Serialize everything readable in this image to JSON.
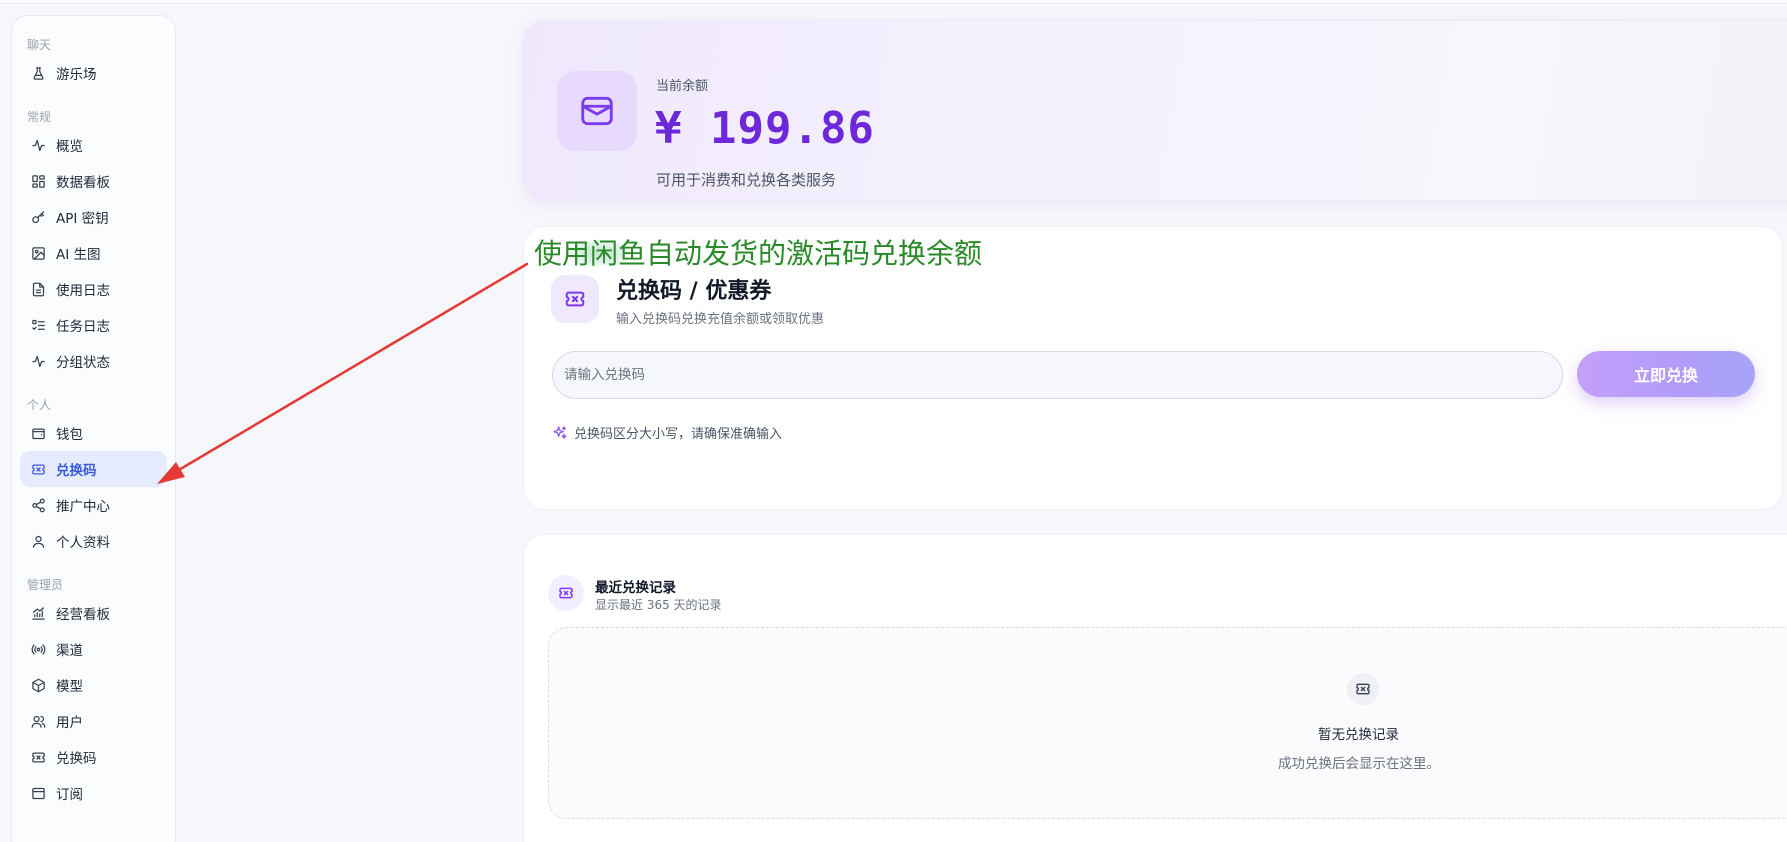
{
  "sidebar": {
    "groups": [
      {
        "label": "聊天",
        "items": [
          {
            "label": "游乐场",
            "icon": "flask-icon"
          }
        ]
      },
      {
        "label": "常规",
        "items": [
          {
            "label": "概览",
            "icon": "activity-icon"
          },
          {
            "label": "数据看板",
            "icon": "grid-icon"
          },
          {
            "label": "API 密钥",
            "icon": "key-icon"
          },
          {
            "label": "AI 生图",
            "icon": "image-icon"
          },
          {
            "label": "使用日志",
            "icon": "file-icon"
          },
          {
            "label": "任务日志",
            "icon": "list-check-icon"
          },
          {
            "label": "分组状态",
            "icon": "activity-icon"
          }
        ]
      },
      {
        "label": "个人",
        "items": [
          {
            "label": "钱包",
            "icon": "wallet-icon"
          },
          {
            "label": "兑换码",
            "icon": "ticket-icon",
            "active": true
          },
          {
            "label": "推广中心",
            "icon": "share-icon"
          },
          {
            "label": "个人资料",
            "icon": "user-icon"
          }
        ]
      },
      {
        "label": "管理员",
        "items": [
          {
            "label": "经营看板",
            "icon": "chart-icon"
          },
          {
            "label": "渠道",
            "icon": "radio-icon"
          },
          {
            "label": "模型",
            "icon": "box-icon"
          },
          {
            "label": "用户",
            "icon": "users-icon"
          },
          {
            "label": "兑换码",
            "icon": "ticket-icon"
          },
          {
            "label": "订阅",
            "icon": "subscription-icon"
          }
        ]
      }
    ]
  },
  "balance": {
    "label": "当前余额",
    "amount": "¥ 199.86",
    "desc": "可用于消费和兑换各类服务",
    "icon": "wallet-icon"
  },
  "redeem": {
    "title": "兑换码 / 优惠券",
    "subtitle": "输入兑换码兑换充值余额或领取优惠",
    "input_placeholder": "请输入兑换码",
    "button_label": "立即兑换",
    "hint": "兑换码区分大小写，请确保准确输入",
    "icon": "ticket-icon"
  },
  "records": {
    "title": "最近兑换记录",
    "subtitle": "显示最近 365 天的记录",
    "empty_title": "暂无兑换记录",
    "empty_desc": "成功兑换后会显示在这里。"
  },
  "annotation": {
    "text": "使用闲鱼自动发货的激活码兑换余额",
    "color": "#2a8a2a",
    "arrow_color": "#e53935"
  },
  "theme": {
    "accent": "#7c3aed",
    "active_nav": "#3b5bdb"
  }
}
